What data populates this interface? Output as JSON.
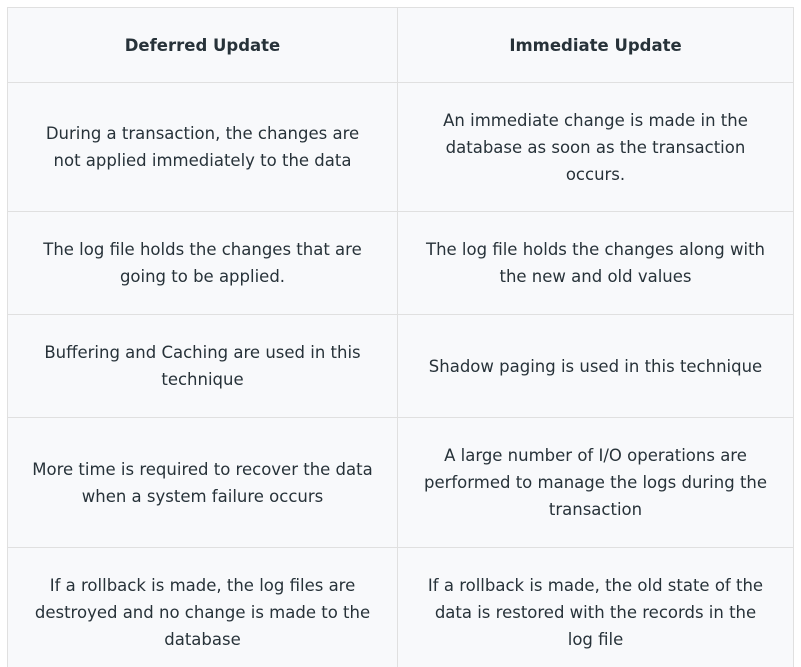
{
  "table": {
    "headers": [
      "Deferred Update",
      "Immediate Update"
    ],
    "rows": [
      [
        "During a transaction, the changes are not applied immediately to the data",
        "An immediate change is made in the database as soon as the transaction occurs."
      ],
      [
        "The log file holds the changes that are going to be applied.",
        "The log file holds the changes along with the new and old values"
      ],
      [
        "Buffering and Caching are used in this technique",
        "Shadow paging is used in this technique"
      ],
      [
        "More time is required to recover the data when a system failure occurs",
        "A large number of I/O operations are performed to manage the logs during the transaction"
      ],
      [
        "If a rollback is made, the log files are destroyed and no change is made to the database",
        "If a rollback is made, the old state of the data is restored with the records in the log file"
      ]
    ]
  }
}
